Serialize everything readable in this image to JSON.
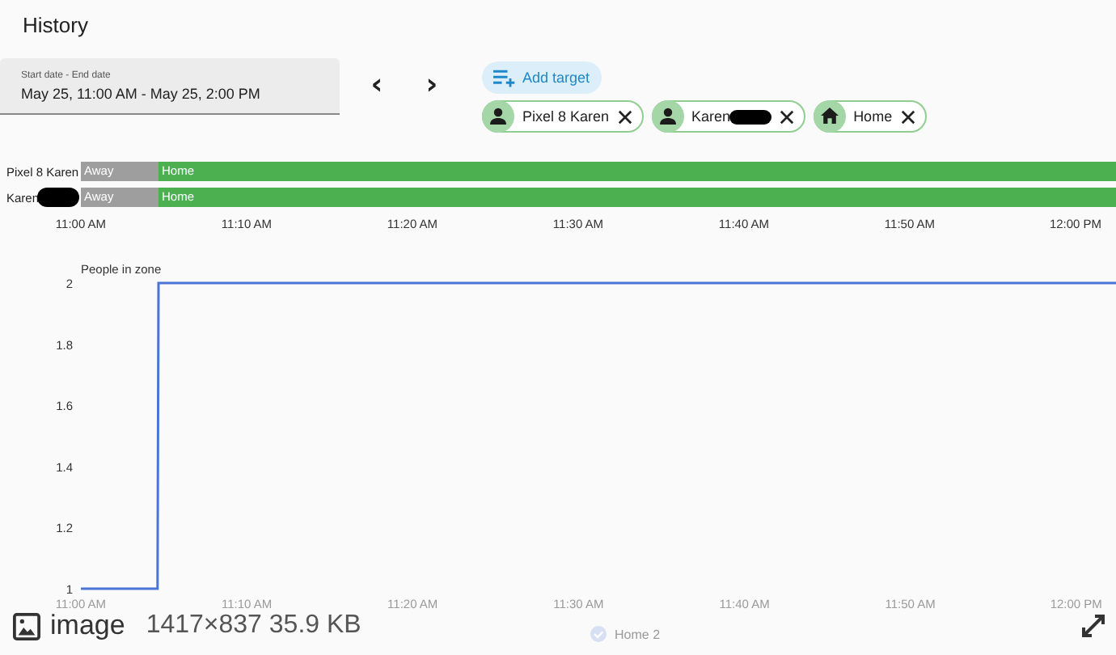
{
  "header": {
    "title": "History"
  },
  "date_range": {
    "label": "Start date - End date",
    "value": "May 25, 11:00 AM - May 25, 2:00 PM"
  },
  "nav": {
    "previous": "‹",
    "next": "›"
  },
  "add_target": {
    "label": "Add target"
  },
  "targets": [
    {
      "label": "Pixel 8 Karen",
      "kind": "person",
      "redacted": false
    },
    {
      "label": "Karen",
      "kind": "person",
      "redacted": true
    },
    {
      "label": "Home",
      "kind": "zone",
      "redacted": false
    }
  ],
  "timeline": {
    "rows": [
      {
        "label": "Pixel 8 Karen",
        "redacted": false,
        "segments": [
          {
            "state": "Away",
            "color": "#9e9e9e",
            "level": 0.075
          },
          {
            "state": "Home",
            "color": "#4caf50",
            "level": 0.925
          }
        ]
      },
      {
        "label": "Karen",
        "redacted": true,
        "segments": [
          {
            "state": "Away",
            "color": "#9e9e9e",
            "level": 0.075
          },
          {
            "state": "Home",
            "color": "#4caf50",
            "level": 0.925
          }
        ]
      }
    ],
    "time_labels": [
      "11:00 AM",
      "11:10 AM",
      "11:20 AM",
      "11:30 AM",
      "11:40 AM",
      "11:50 AM",
      "12:00 PM"
    ]
  },
  "history_chart": {
    "chart_data": {
      "type": "line",
      "ylabel": "People in zone",
      "x": [
        11,
        11.077,
        11.078,
        12.04
      ],
      "series": [
        {
          "name": "Home 2",
          "color": "#4a74d6",
          "values": [
            1,
            1,
            2,
            2
          ]
        }
      ],
      "xlim": [
        11,
        12.04
      ],
      "ylim": [
        1,
        2
      ],
      "yticks": [
        1,
        1.2,
        1.4,
        1.6,
        1.8,
        2
      ],
      "xticks": [
        {
          "value": 11,
          "label": "11:00 AM"
        },
        {
          "value": 11.1667,
          "label": "11:10 AM"
        },
        {
          "value": 11.3333,
          "label": "11:20 AM"
        },
        {
          "value": 11.5,
          "label": "11:30 AM"
        },
        {
          "value": 11.6667,
          "label": "11:40 AM"
        },
        {
          "value": 11.8333,
          "label": "11:50 AM"
        },
        {
          "value": 12,
          "label": "12:00 PM"
        }
      ]
    }
  },
  "image_overlay": {
    "label": "image",
    "info": "1417×837 35.9 KB"
  }
}
